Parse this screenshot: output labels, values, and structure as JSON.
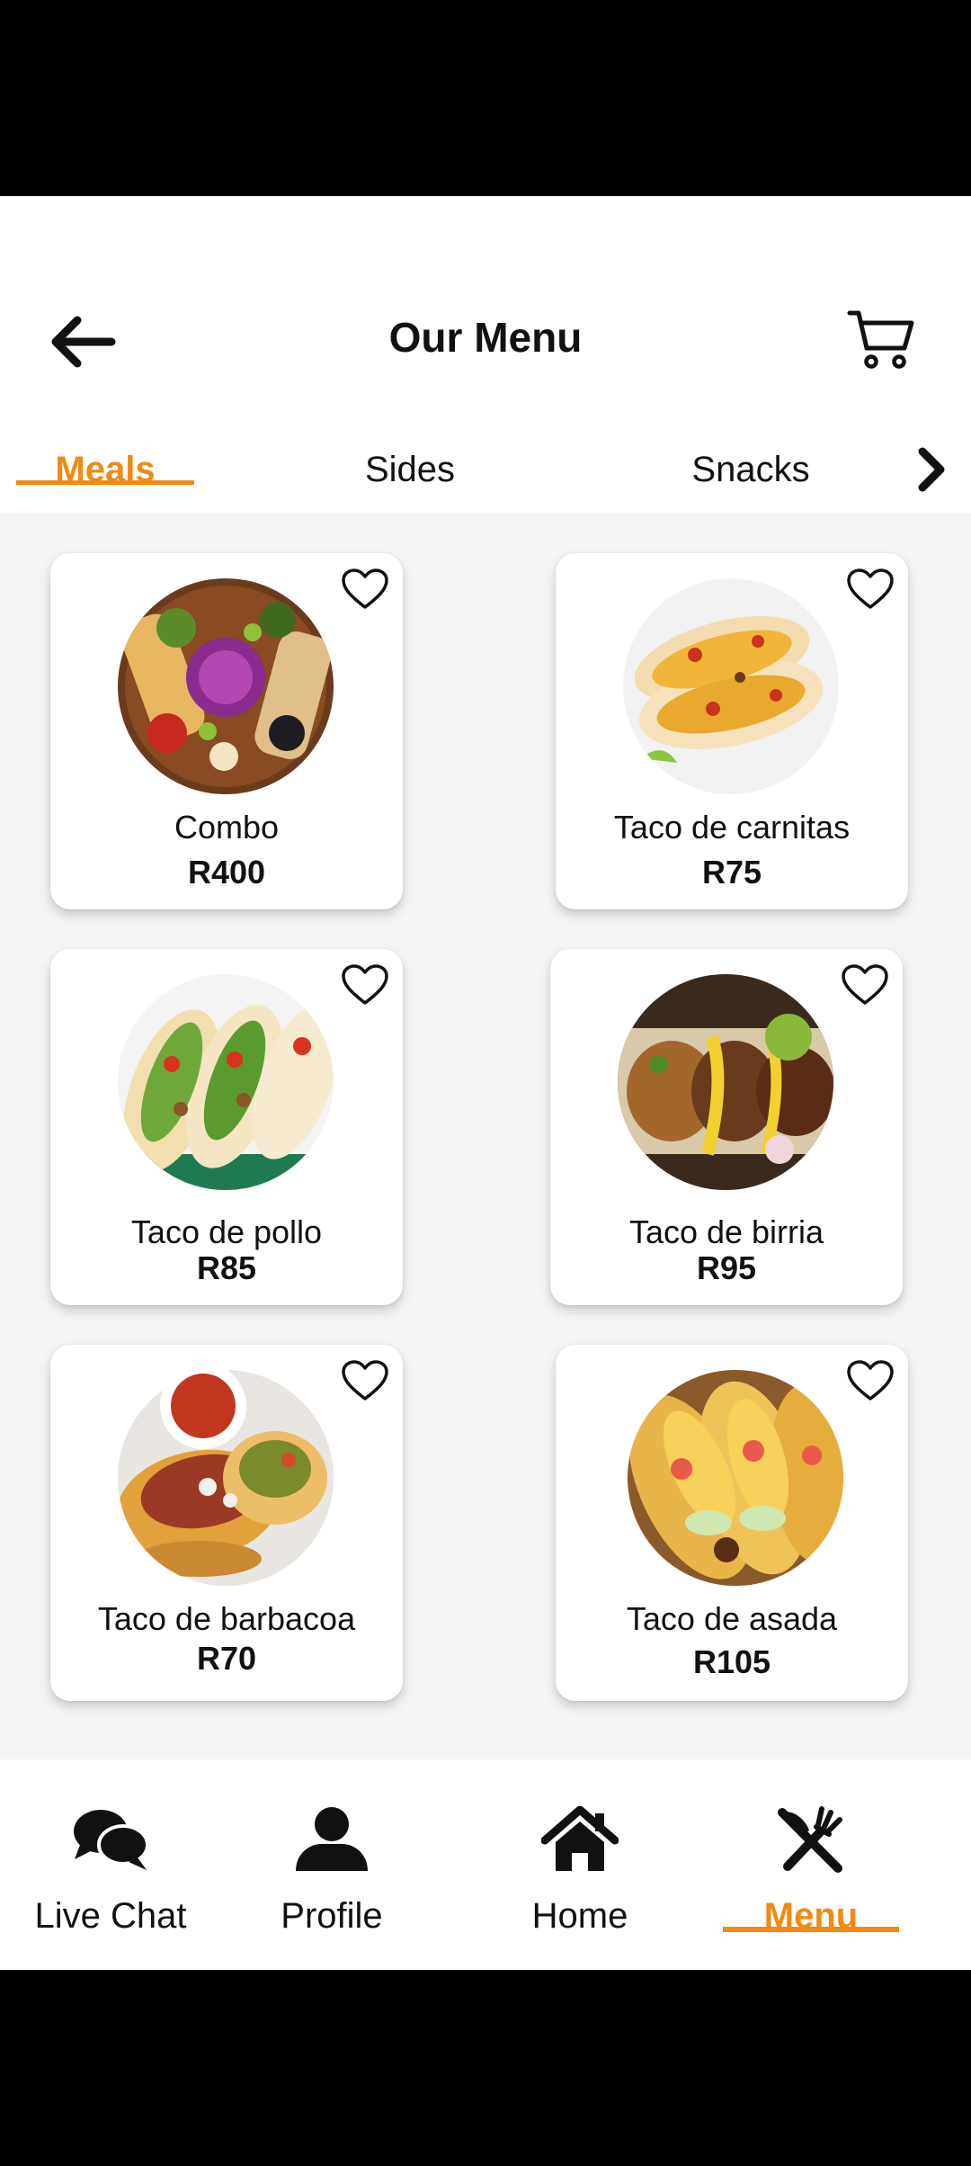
{
  "header": {
    "title": "Our Menu"
  },
  "tabs": [
    {
      "label": "Meals",
      "active": true
    },
    {
      "label": "Sides",
      "active": false
    },
    {
      "label": "Snacks",
      "active": false
    }
  ],
  "items": [
    {
      "name": "Combo",
      "price": "R400"
    },
    {
      "name": "Taco de carnitas",
      "price": "R75"
    },
    {
      "name": "Taco de pollo",
      "price": "R85"
    },
    {
      "name": "Taco de birria",
      "price": "R95"
    },
    {
      "name": "Taco de barbacoa",
      "price": "R70"
    },
    {
      "name": "Taco de asada",
      "price": "R105"
    }
  ],
  "nav": [
    {
      "label": "Live Chat",
      "icon": "chat-icon"
    },
    {
      "label": "Profile",
      "icon": "user-icon"
    },
    {
      "label": "Home",
      "icon": "home-icon"
    },
    {
      "label": "Menu",
      "icon": "utensils-icon",
      "active": true
    }
  ],
  "colors": {
    "accent": "#f08a12",
    "text": "#111111",
    "background": "#f5f5f5"
  }
}
